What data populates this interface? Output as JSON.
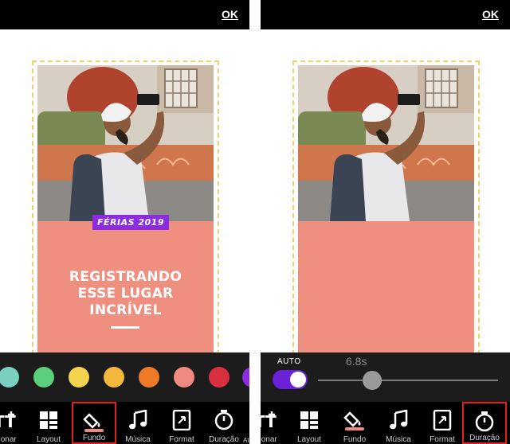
{
  "left_panel": {
    "ok_label": "OK",
    "badge_text": "FÉRIAS 2019",
    "headline": [
      "REGISTRANDO",
      "ESSE LUGAR",
      "INCRÍVEL"
    ],
    "swatches": [
      "#7ad0c0",
      "#5ccf7a",
      "#f4d44e",
      "#f3b73c",
      "#ee7a27",
      "#f0897f",
      "#d92f3f",
      "#8b2be2"
    ],
    "toolbar": [
      {
        "label": "icionar",
        "icon": "text-add-icon"
      },
      {
        "label": "Layout",
        "icon": "layout-icon"
      },
      {
        "label": "Fundo",
        "icon": "paint-bucket-icon",
        "selected": true
      },
      {
        "label": "Música",
        "icon": "music-note-icon"
      },
      {
        "label": "Format",
        "icon": "format-icon"
      },
      {
        "label": "Duração",
        "icon": "timer-icon"
      }
    ],
    "overflow_label": "At"
  },
  "right_panel": {
    "ok_label": "OK",
    "auto_label": "AUTO",
    "duration_value": "6.8s",
    "duration_fraction": 0.3,
    "toolbar": [
      {
        "label": "icionar",
        "icon": "text-add-icon"
      },
      {
        "label": "Layout",
        "icon": "layout-icon"
      },
      {
        "label": "Fundo",
        "icon": "paint-bucket-icon"
      },
      {
        "label": "Música",
        "icon": "music-note-icon"
      },
      {
        "label": "Format",
        "icon": "format-icon"
      },
      {
        "label": "Duração",
        "icon": "timer-icon",
        "selected": true
      }
    ]
  },
  "colors": {
    "accent_purple": "#8b2be2",
    "card_salmon": "#ef8f80",
    "selection_red": "#e0201f",
    "frame_dashed": "#f1cf6a"
  }
}
